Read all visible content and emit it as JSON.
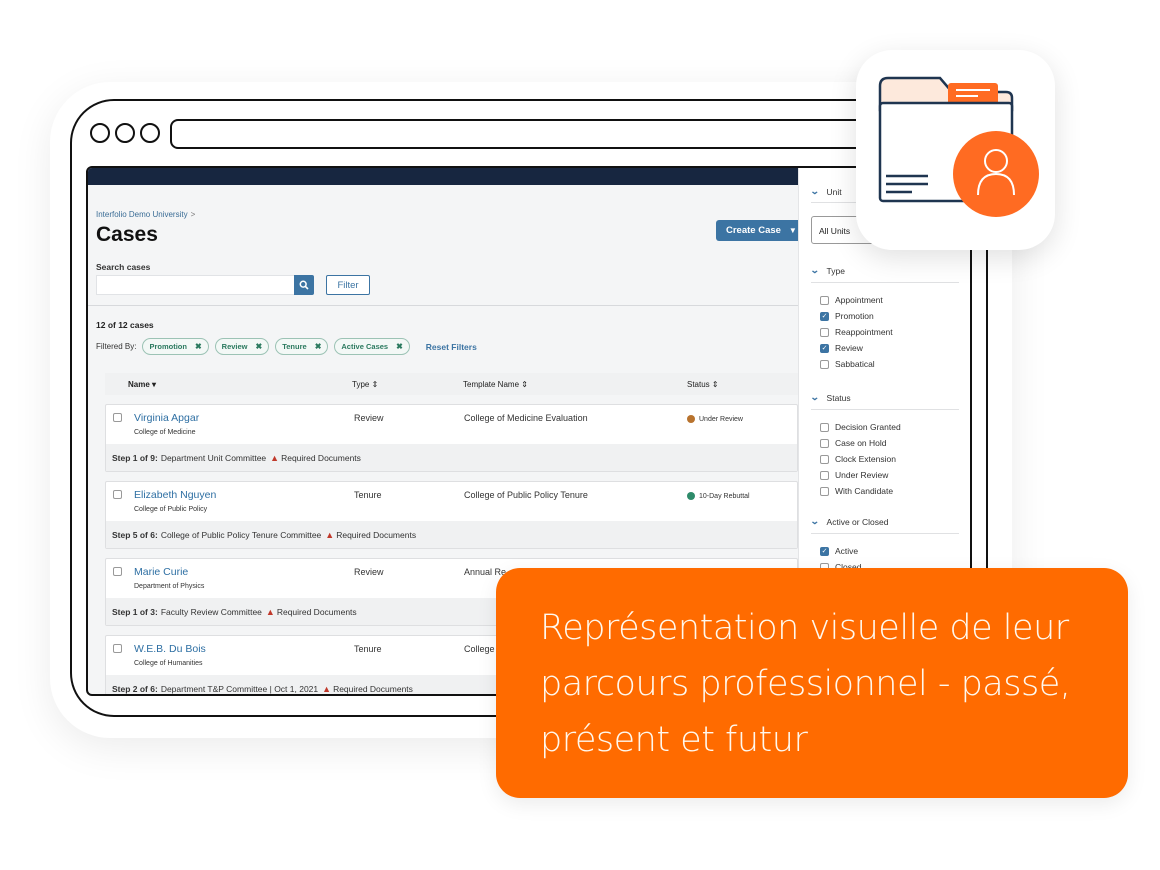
{
  "breadcrumb": {
    "root": "Interfolio Demo University",
    "separator": ">"
  },
  "page": {
    "title": "Cases"
  },
  "search": {
    "label": "Search cases",
    "value": "",
    "placeholder": "",
    "filter_button": "Filter"
  },
  "actions": {
    "create_case": "Create Case"
  },
  "results": {
    "count_text": "12 of 12 cases"
  },
  "filters_applied": {
    "label": "Filtered By:",
    "chips": [
      {
        "label": "Promotion"
      },
      {
        "label": "Review"
      },
      {
        "label": "Tenure"
      },
      {
        "label": "Active Cases"
      }
    ],
    "reset_label": "Reset Filters"
  },
  "table": {
    "headers": {
      "name": "Name",
      "type": "Type",
      "template": "Template Name",
      "status": "Status"
    },
    "rows": [
      {
        "name": "Virginia Apgar",
        "unit": "College of Medicine",
        "type": "Review",
        "template": "College of Medicine Evaluation",
        "status": "Under Review",
        "status_color": "#b8732e",
        "step_label": "Step 1 of 9:",
        "step_text": "Department Unit Committee",
        "alert": "Required Documents"
      },
      {
        "name": "Elizabeth Nguyen",
        "unit": "College of Public Policy",
        "type": "Tenure",
        "template": "College of Public Policy Tenure",
        "status": "10-Day Rebuttal",
        "status_color": "#2e8b6a",
        "step_label": "Step 5 of 6:",
        "step_text": "College of Public Policy Tenure Committee",
        "alert": "Required Documents"
      },
      {
        "name": "Marie Curie",
        "unit": "Department of Physics",
        "type": "Review",
        "template": "Annual Re",
        "status": "",
        "status_color": "",
        "step_label": "Step 1 of 3:",
        "step_text": "Faculty Review Committee",
        "alert": "Required Documents"
      },
      {
        "name": "W.E.B. Du Bois",
        "unit": "College of Humanities",
        "type": "Tenure",
        "template": "College o",
        "status": "",
        "status_color": "",
        "step_label": "Step 2 of 6:",
        "step_text": "Department T&P Committee |  Oct 1, 2021",
        "alert": "Required Documents"
      }
    ]
  },
  "filter_panel": {
    "unit": {
      "label": "Unit",
      "selected": "All Units"
    },
    "type": {
      "label": "Type",
      "options": [
        {
          "label": "Appointment",
          "checked": false
        },
        {
          "label": "Promotion",
          "checked": true
        },
        {
          "label": "Reappointment",
          "checked": false
        },
        {
          "label": "Review",
          "checked": true
        },
        {
          "label": "Sabbatical",
          "checked": false
        }
      ]
    },
    "status": {
      "label": "Status",
      "options": [
        {
          "label": "Decision Granted",
          "checked": false
        },
        {
          "label": "Case on Hold",
          "checked": false
        },
        {
          "label": "Clock Extension",
          "checked": false
        },
        {
          "label": "Under Review",
          "checked": false
        },
        {
          "label": "With Candidate",
          "checked": false
        }
      ]
    },
    "active_closed": {
      "label": "Active or Closed",
      "options": [
        {
          "label": "Active",
          "checked": true
        },
        {
          "label": "Closed",
          "checked": false
        }
      ]
    }
  },
  "callout": {
    "text": "Représentation visuelle de leur parcours professionnel - passé, présent et futur"
  },
  "colors": {
    "accent_orange": "#ff6b00",
    "primary_blue": "#3c74a3",
    "navy": "#172640",
    "chip_green": "#2b7a5f"
  }
}
